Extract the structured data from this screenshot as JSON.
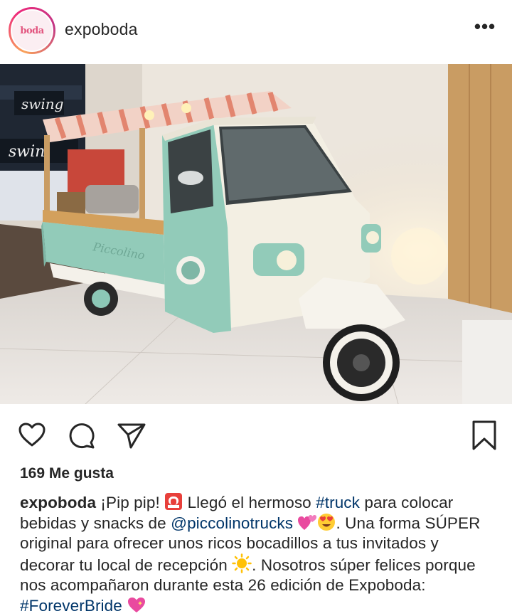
{
  "post": {
    "username": "expoboda",
    "avatar_logo": "boda",
    "more_icon": "•••",
    "likes_text": "169 Me gusta"
  },
  "icons": {
    "like": "heart-icon",
    "comment": "comment-icon",
    "share": "send-icon",
    "save": "bookmark-icon"
  },
  "caption": {
    "user": "expoboda",
    "t1": " ¡Pip pip! ",
    "emoji_siren": "siren-emoji",
    "t2": " Llegó el hermoso ",
    "tag_truck": "#truck",
    "t3": " para colocar bebidas y snacks de ",
    "mention": "@piccolinotrucks",
    "emoji_hearts": "two-hearts-emoji",
    "emoji_love": "heart-eyes-emoji",
    "t4": ". Una forma SÚPER original para ofrecer unos ricos bocadillos a tus invitados y decorar tu local de recepción ",
    "emoji_sun": "sun-emoji",
    "t5": ". Nosotros súper felices porque nos acompañaron durante esta 26 edición de Expoboda: ",
    "tag_bride": "#ForeverBride",
    "emoji_sparkle_heart": "sparkling-heart-emoji"
  },
  "photo_signs": {
    "sign1": "swing",
    "sign2": "swin",
    "truck_label": "Piccolino"
  },
  "colors": {
    "link": "#003569",
    "text": "#262626",
    "truck_mint": "#8cc7b6",
    "avatar_accent": "#e2557f"
  }
}
